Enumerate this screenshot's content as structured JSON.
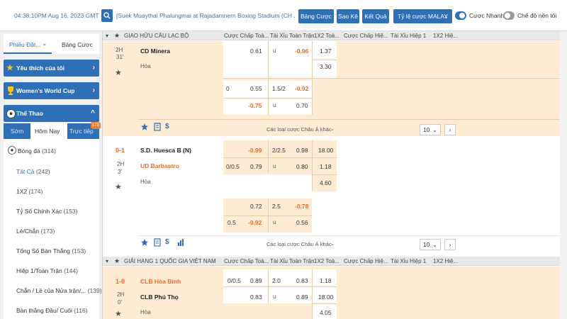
{
  "topbar": {
    "time": "04:38:10PM Aug 16, 2023 GMT +7",
    "marquee": "[Suek Muaythai Phalungmai at Rajadamnern Boxing Stadium (CH JKN18)",
    "btn_table": "Bảng Cược",
    "btn_statement": "Sao Kê",
    "btn_results": "Kết Quả",
    "odds_type": "Tỷ lệ cược MALAY",
    "fast_bet": "Cược Nhanh",
    "background_mode": "Chế độ nền tối"
  },
  "sidebar": {
    "tab_betslip": "Phiếu Đặt...",
    "tab_betlist": "Bảng Cược",
    "favorites": "Yêu thích của tôi",
    "womens_cup": "Women's World Cup",
    "sports": "Thể Thao",
    "sub_early": "Sớm",
    "sub_today": "Hôm Nay",
    "sub_live": "Trực tiếp",
    "live_count": "178",
    "football": "Bóng đá",
    "football_count": "(314)",
    "items": [
      {
        "label": "Tất Cả",
        "count": "(242)"
      },
      {
        "label": "1X2",
        "count": "(174)"
      },
      {
        "label": "Tỷ Số Chính Xác",
        "count": "(153)"
      },
      {
        "label": "Lẻ/Chẵn",
        "count": "(173)"
      },
      {
        "label": "Tổng Số Bàn Thắng",
        "count": "(153)"
      },
      {
        "label": "Hiệp 1/Toàn Trận",
        "count": "(144)"
      },
      {
        "label": "Chẵn / Lẻ của Nửa trận/...",
        "count": "(139)"
      },
      {
        "label": "Bàn thắng Đầu/ Cuối",
        "count": "(116)"
      }
    ]
  },
  "columns": {
    "hdp_ft": "Cược Chấp Toà...",
    "ou_ft": "Tài Xỉu Toàn Trận",
    "x12_ft": "1X2 Toà...",
    "hdp_h1": "Cược Chấp Hiệ...",
    "ou_h1": "Tài Xỉu Hiệp 1",
    "x12_h1": "1X2 Hiệ..."
  },
  "league1": "GIAO HỮU CÂU LẠC BỘ",
  "league2": "GIẢI HẠNG 1 QUỐC GIA VIỆT NAM",
  "more_markets": "Các loại cược Châu Á khác",
  "page_size": "10",
  "match1": {
    "period": "2H",
    "minute": "31'",
    "home": "CD Minera",
    "draw": "Hòa",
    "r1": {
      "hdp": "",
      "hdp_odds": "0.61",
      "ou_line": "",
      "ou_u": "u",
      "ou_odds": "-0.96",
      "x12": "1.37"
    },
    "x12_draw": "3.30",
    "r2": {
      "hdp": "0",
      "hdp_odds": "0.55",
      "ou_line": "1.5/2",
      "ou_odds": "-0.92"
    },
    "r3": {
      "hdp_odds": "-0.75",
      "ou_u": "u",
      "ou_odds": "0.70"
    }
  },
  "match2": {
    "score": "0-1",
    "period": "2H",
    "minute": "3'",
    "home": "S.D. Huesca B (N)",
    "away": "UD Barbastro",
    "draw": "Hòa",
    "r1": {
      "hdp_odds": "-0.99",
      "ou_line": "2/2.5",
      "ou_odds": "0.98",
      "x12": "18.00"
    },
    "r2": {
      "hdp": "0/0.5",
      "hdp_odds": "0.79",
      "ou_u": "u",
      "ou_odds": "0.80",
      "x12": "1.18"
    },
    "x12_draw": "4.60",
    "r3": {
      "hdp_odds": "0.72",
      "ou_line": "2.5",
      "ou_odds": "-0.78"
    },
    "r4": {
      "hdp": "0.5",
      "hdp_odds": "-0.92",
      "ou_u": "u",
      "ou_odds": "0.56"
    }
  },
  "match3": {
    "score": "1-0",
    "period": "2H",
    "minute": "0'",
    "home": "CLB Hòa Bình",
    "away": "CLB Phú Thọ",
    "draw": "Hòa",
    "r1": {
      "hdp": "0/0.5",
      "hdp_odds": "0.89",
      "ou_line": "2.0",
      "ou_odds": "0.83",
      "x12": "1.18"
    },
    "r2": {
      "hdp_odds": "0.83",
      "ou_u": "u",
      "ou_odds": "0.89",
      "x12": "18.00"
    },
    "x12_draw": "4.05"
  }
}
